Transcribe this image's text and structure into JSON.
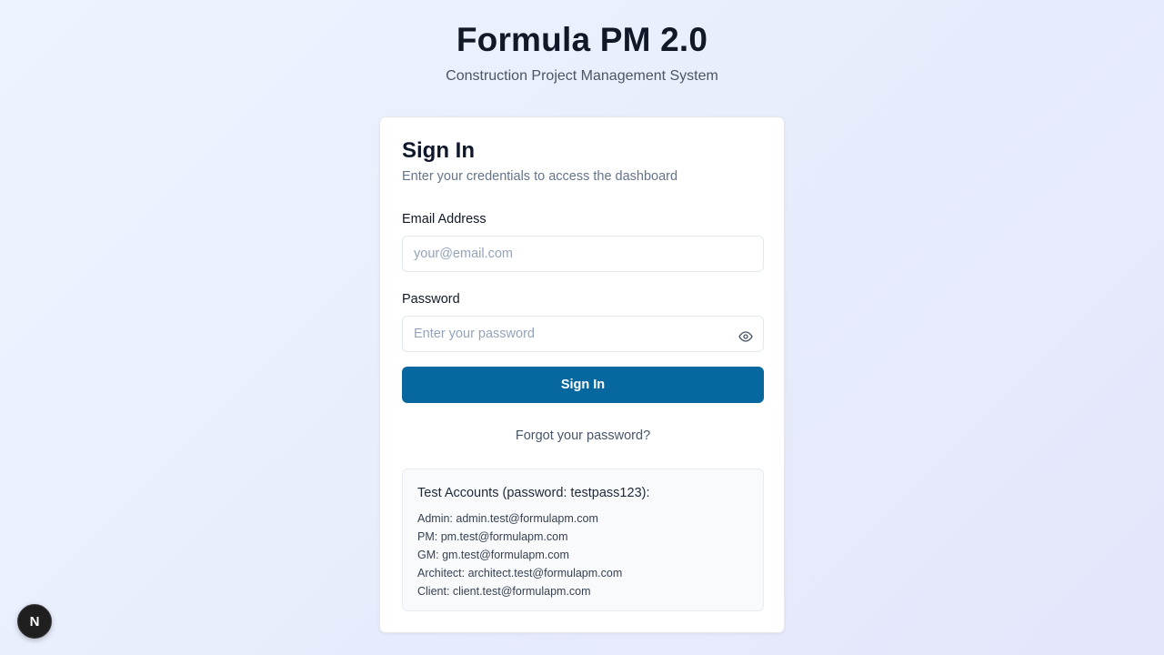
{
  "header": {
    "title": "Formula PM 2.0",
    "subtitle": "Construction Project Management System"
  },
  "card": {
    "title": "Sign In",
    "description": "Enter your credentials to access the dashboard",
    "email": {
      "label": "Email Address",
      "placeholder": "your@email.com",
      "value": ""
    },
    "password": {
      "label": "Password",
      "placeholder": "Enter your password",
      "value": "",
      "toggle_icon": "eye-icon"
    },
    "submit_label": "Sign In",
    "forgot_label": "Forgot your password?"
  },
  "test_accounts": {
    "title": "Test Accounts (password: testpass123):",
    "accounts": [
      "Admin: admin.test@formulapm.com",
      "PM: pm.test@formulapm.com",
      "GM: gm.test@formulapm.com",
      "Architect: architect.test@formulapm.com",
      "Client: client.test@formulapm.com"
    ]
  },
  "dev_badge": {
    "label": "N",
    "icon": "nextjs-logo-icon"
  },
  "colors": {
    "primary": "#07689f",
    "title_text": "#111827",
    "muted_text": "#64748b"
  }
}
